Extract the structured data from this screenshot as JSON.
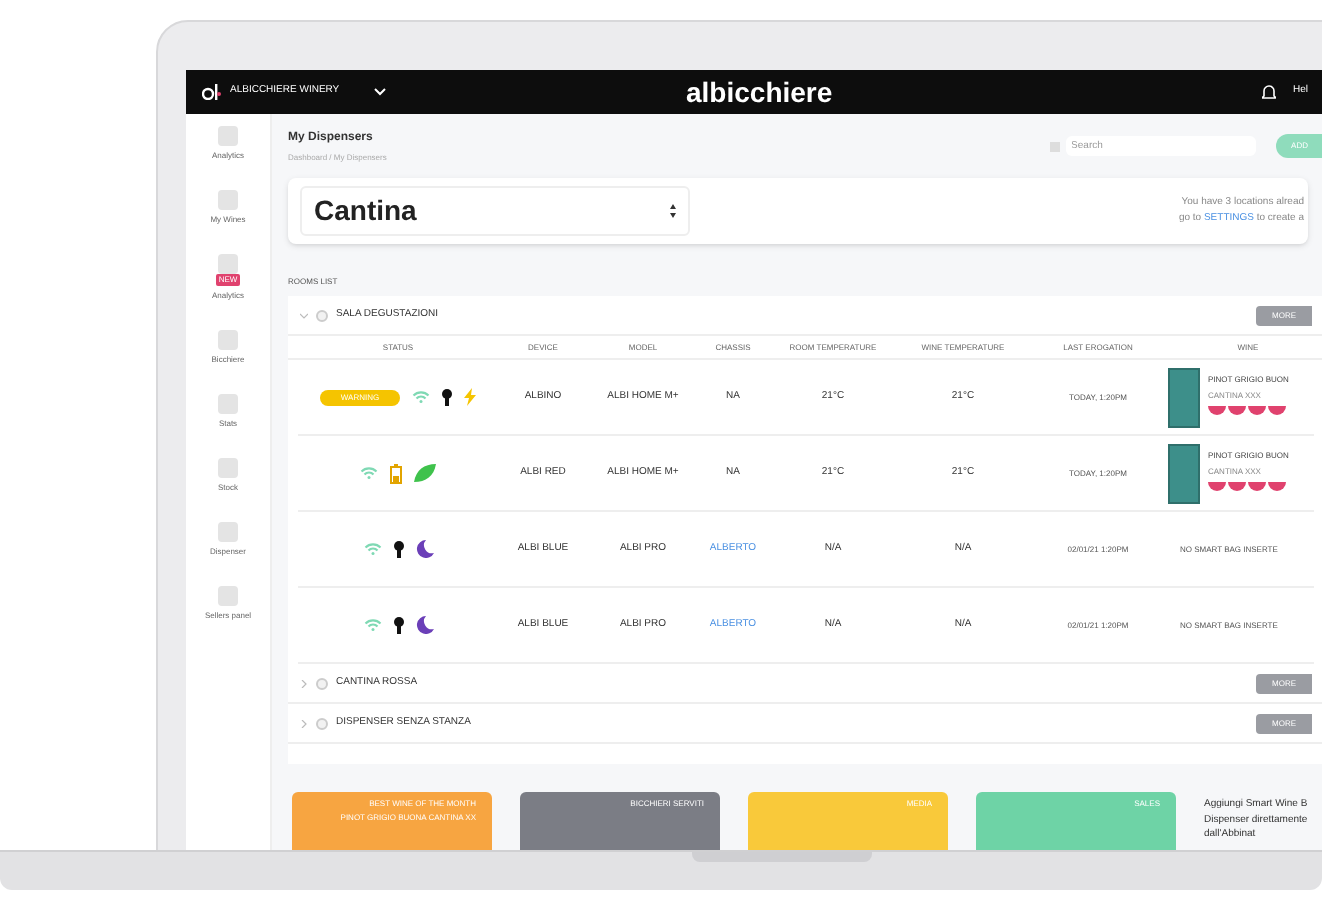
{
  "topbar": {
    "company": "ALBICCHIERE WINERY",
    "logo": "albicchiere",
    "user": "Hel"
  },
  "sidebar": {
    "items": [
      {
        "label": "Analytics"
      },
      {
        "label": "My Wines"
      },
      {
        "label": "Analytics",
        "badge": "NEW"
      },
      {
        "label": "Bicchiere"
      },
      {
        "label": "Stats"
      },
      {
        "label": "Stock"
      },
      {
        "label": "Dispenser"
      },
      {
        "label": "Sellers panel"
      }
    ]
  },
  "header": {
    "title": "My Dispensers",
    "breadcrumb": "Dashboard / My Dispensers",
    "search": {
      "placeholder": "Search"
    },
    "add_button": "ADD"
  },
  "location": {
    "value": "Cantina",
    "info_line_1": "You have 3 locations alread",
    "info_prefix": "go to ",
    "info_link": "SETTINGS",
    "info_suffix": " to create a"
  },
  "rooms": {
    "title": "ROOMS LIST",
    "columns": [
      "STATUS",
      "DEVICE",
      "MODEL",
      "CHASSIS",
      "ROOM TEMPERATURE",
      "WINE TEMPERATURE",
      "LAST EROGATION",
      "WINE"
    ],
    "list": [
      {
        "name": "SALA DEGUSTAZIONI",
        "checked": false,
        "expanded": true,
        "button": "MORE",
        "devices": [
          {
            "badge": "WARNING",
            "icons": [
              {
                "kind": "wifi"
              },
              {
                "kind": "bulb"
              },
              {
                "kind": "bolt"
              }
            ],
            "device": "ALBINO",
            "model": "ALBI HOME M+",
            "chassis": "NA",
            "chassis_link": false,
            "room_temp": "21°C",
            "wine_temp": "21°C",
            "last": "TODAY, 1:20PM",
            "wine": {
              "kind": "bag",
              "name": "PINOT GRIGIO BUON",
              "producer": "CANTINA XXX"
            }
          },
          {
            "icons": [
              {
                "kind": "wifi"
              },
              {
                "kind": "battery"
              },
              {
                "kind": "leaf"
              }
            ],
            "device": "ALBI RED",
            "model": "ALBI HOME M+",
            "chassis": "NA",
            "chassis_link": false,
            "room_temp": "21°C",
            "wine_temp": "21°C",
            "last": "TODAY, 1:20PM",
            "wine": {
              "kind": "bag",
              "name": "PINOT GRIGIO BUON",
              "producer": "CANTINA XXX"
            }
          },
          {
            "icons": [
              {
                "kind": "wifi"
              },
              {
                "kind": "bulb"
              },
              {
                "kind": "moon"
              }
            ],
            "device": "ALBI BLUE",
            "model": "ALBI PRO",
            "chassis": "ALBERTO",
            "chassis_link": true,
            "room_temp": "N/A",
            "wine_temp": "N/A",
            "last": "02/01/21 1:20PM",
            "wine": {
              "kind": "empty",
              "name": "NO SMART BAG INSERTE"
            }
          },
          {
            "icons": [
              {
                "kind": "wifi"
              },
              {
                "kind": "bulb"
              },
              {
                "kind": "moon"
              }
            ],
            "device": "ALBI BLUE",
            "model": "ALBI PRO",
            "chassis": "ALBERTO",
            "chassis_link": true,
            "room_temp": "N/A",
            "wine_temp": "N/A",
            "last": "02/01/21 1:20PM",
            "wine": {
              "kind": "empty",
              "name": "NO SMART BAG INSERTE"
            }
          }
        ]
      },
      {
        "name": "CANTINA ROSSA",
        "checked": false,
        "expanded": false,
        "button": "MORE"
      },
      {
        "name": "DISPENSER SENZA STANZA",
        "checked": false,
        "expanded": false,
        "button": "MORE"
      }
    ]
  },
  "cards": [
    {
      "color": "#f7a541",
      "title": "BEST WINE OF THE MONTH",
      "subtitle": "PINOT GRIGIO BUONA CANTINA XX"
    },
    {
      "color": "#7b7d85",
      "title": "BICCHIERI SERVITI"
    },
    {
      "color": "#f9c93a",
      "title": "MEDIA"
    },
    {
      "color": "#6ed3a6",
      "title": "SALES"
    }
  ],
  "promo": "Aggiungi Smart Wine B Dispenser direttamente dall'Abbinat"
}
